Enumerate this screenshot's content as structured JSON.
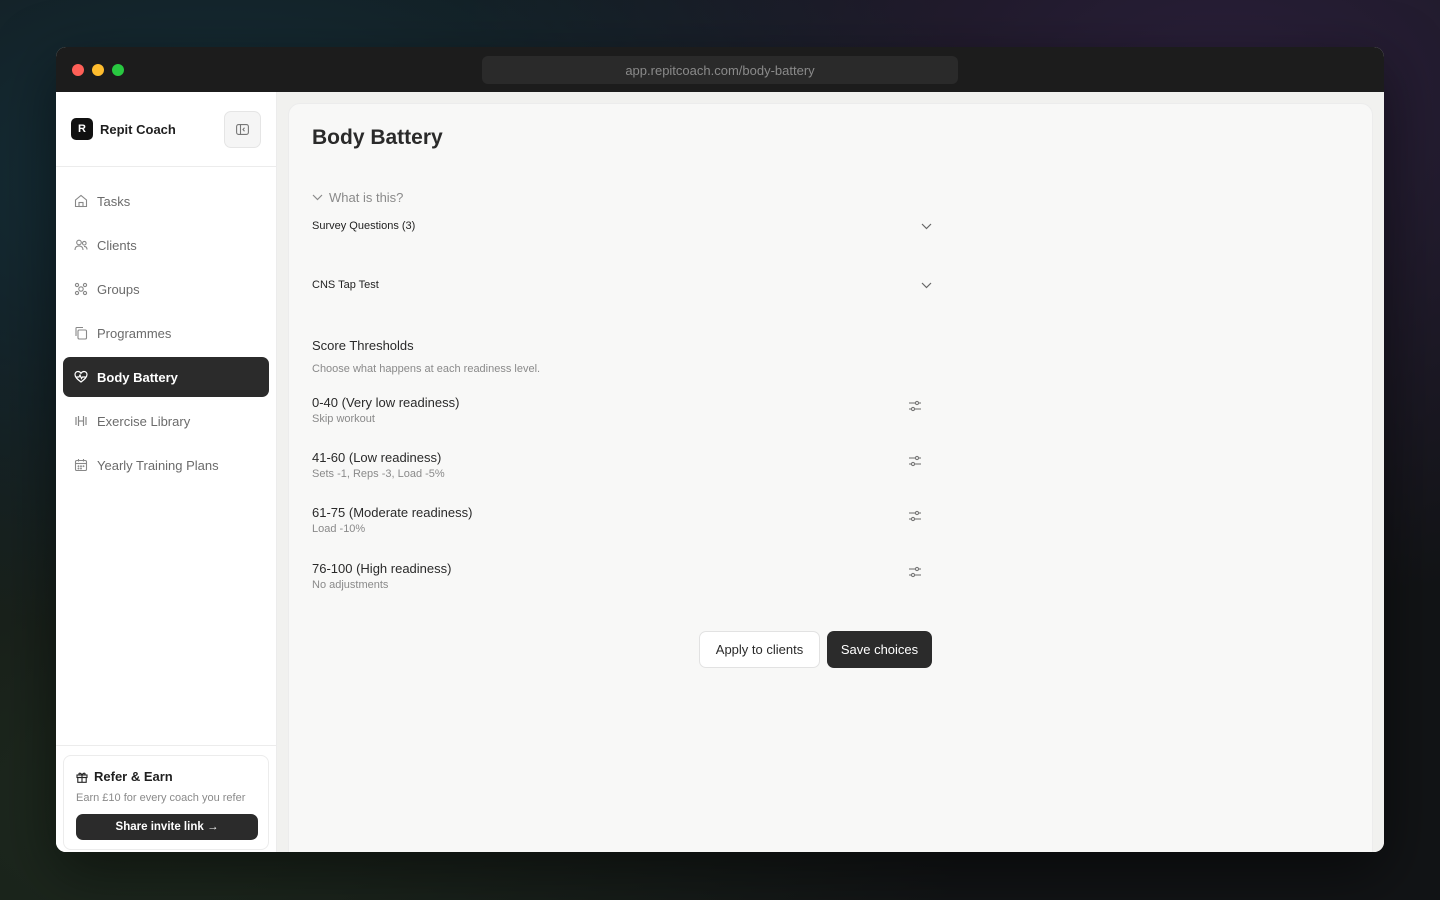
{
  "browser": {
    "url": "app.repitcoach.com/body-battery",
    "traffic_colors": [
      "#fe5f57",
      "#febc2e",
      "#28c840"
    ]
  },
  "sidebar": {
    "brand": "Repit Coach",
    "logo_letter": "R",
    "items": [
      {
        "label": "Tasks",
        "icon": "home-icon",
        "active": false
      },
      {
        "label": "Clients",
        "icon": "users-icon",
        "active": false
      },
      {
        "label": "Groups",
        "icon": "groups-icon",
        "active": false
      },
      {
        "label": "Programmes",
        "icon": "copy-icon",
        "active": false
      },
      {
        "label": "Body Battery",
        "icon": "heart-pulse-icon",
        "active": true
      },
      {
        "label": "Exercise Library",
        "icon": "dumbbell-icon",
        "active": false
      },
      {
        "label": "Yearly Training Plans",
        "icon": "calendar-icon",
        "active": false
      }
    ],
    "refer": {
      "title": "Refer & Earn",
      "subtitle": "Earn £10 for every coach you refer",
      "button": "Share invite link →"
    }
  },
  "main": {
    "title": "Body Battery",
    "what_is_this": "What is this?",
    "accordions": [
      {
        "label": "Survey Questions (3)"
      },
      {
        "label": "CNS Tap Test"
      }
    ],
    "thresholds": {
      "title": "Score Thresholds",
      "subtitle": "Choose what happens at each readiness level.",
      "rows": [
        {
          "range": "0-40 (Very low readiness)",
          "action": "Skip workout"
        },
        {
          "range": "41-60 (Low readiness)",
          "action": "Sets -1, Reps -3, Load -5%"
        },
        {
          "range": "61-75 (Moderate readiness)",
          "action": "Load -10%"
        },
        {
          "range": "76-100 (High readiness)",
          "action": "No adjustments"
        }
      ]
    },
    "apply_button": "Apply to clients",
    "save_button": "Save choices"
  },
  "colors": {
    "active_nav": "#2b2b2b",
    "primary_button": "#2b2b2b"
  }
}
